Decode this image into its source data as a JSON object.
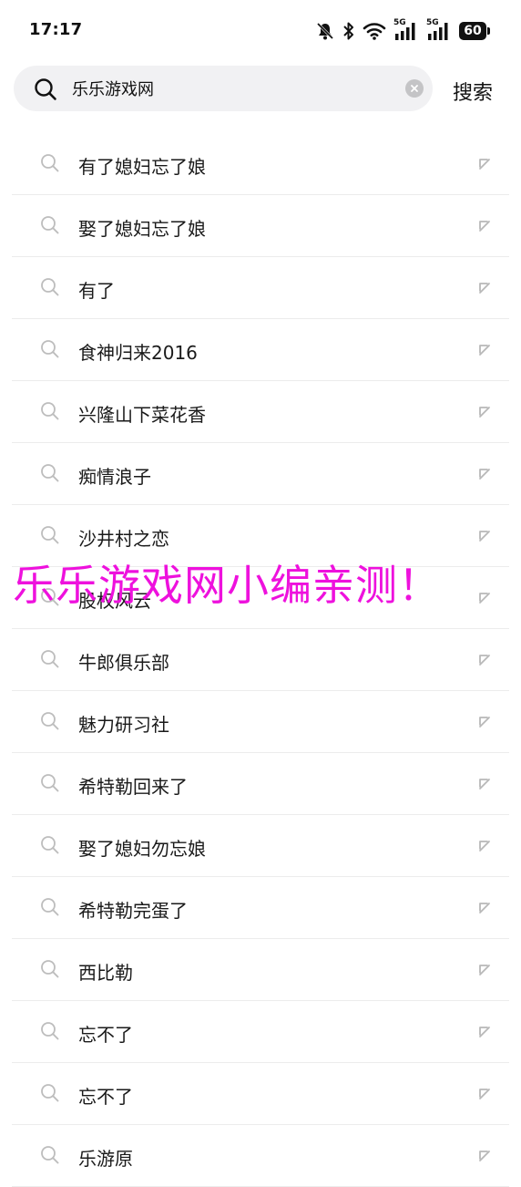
{
  "status_bar": {
    "time": "17:17",
    "network_label_1": "5G",
    "network_label_2": "5G",
    "battery": "60"
  },
  "search": {
    "query": "乐乐游戏网",
    "button_label": "搜索"
  },
  "suggestions": [
    {
      "text": "有了媳妇忘了娘"
    },
    {
      "text": "娶了媳妇忘了娘"
    },
    {
      "text": "有了"
    },
    {
      "text": "食神归来2016"
    },
    {
      "text": "兴隆山下菜花香"
    },
    {
      "text": "痴情浪子"
    },
    {
      "text": "沙井村之恋"
    },
    {
      "text": "股权风云"
    },
    {
      "text": "牛郎俱乐部"
    },
    {
      "text": "魅力研习社"
    },
    {
      "text": "希特勒回来了"
    },
    {
      "text": "娶了媳妇勿忘娘"
    },
    {
      "text": "希特勒完蛋了"
    },
    {
      "text": "西比勒"
    },
    {
      "text": "忘不了"
    },
    {
      "text": "忘不了"
    },
    {
      "text": "乐游原"
    }
  ],
  "watermark": {
    "text": "乐乐游戏网小编亲测！",
    "color": "#ee11dd"
  },
  "icons": {
    "search": "search-icon",
    "clear": "clear-icon",
    "fill_arrow": "arrow-up-left-icon",
    "mute": "bell-off-icon",
    "bluetooth": "bluetooth-icon",
    "wifi": "wifi-icon",
    "signal": "signal-icon",
    "battery": "battery-icon"
  }
}
